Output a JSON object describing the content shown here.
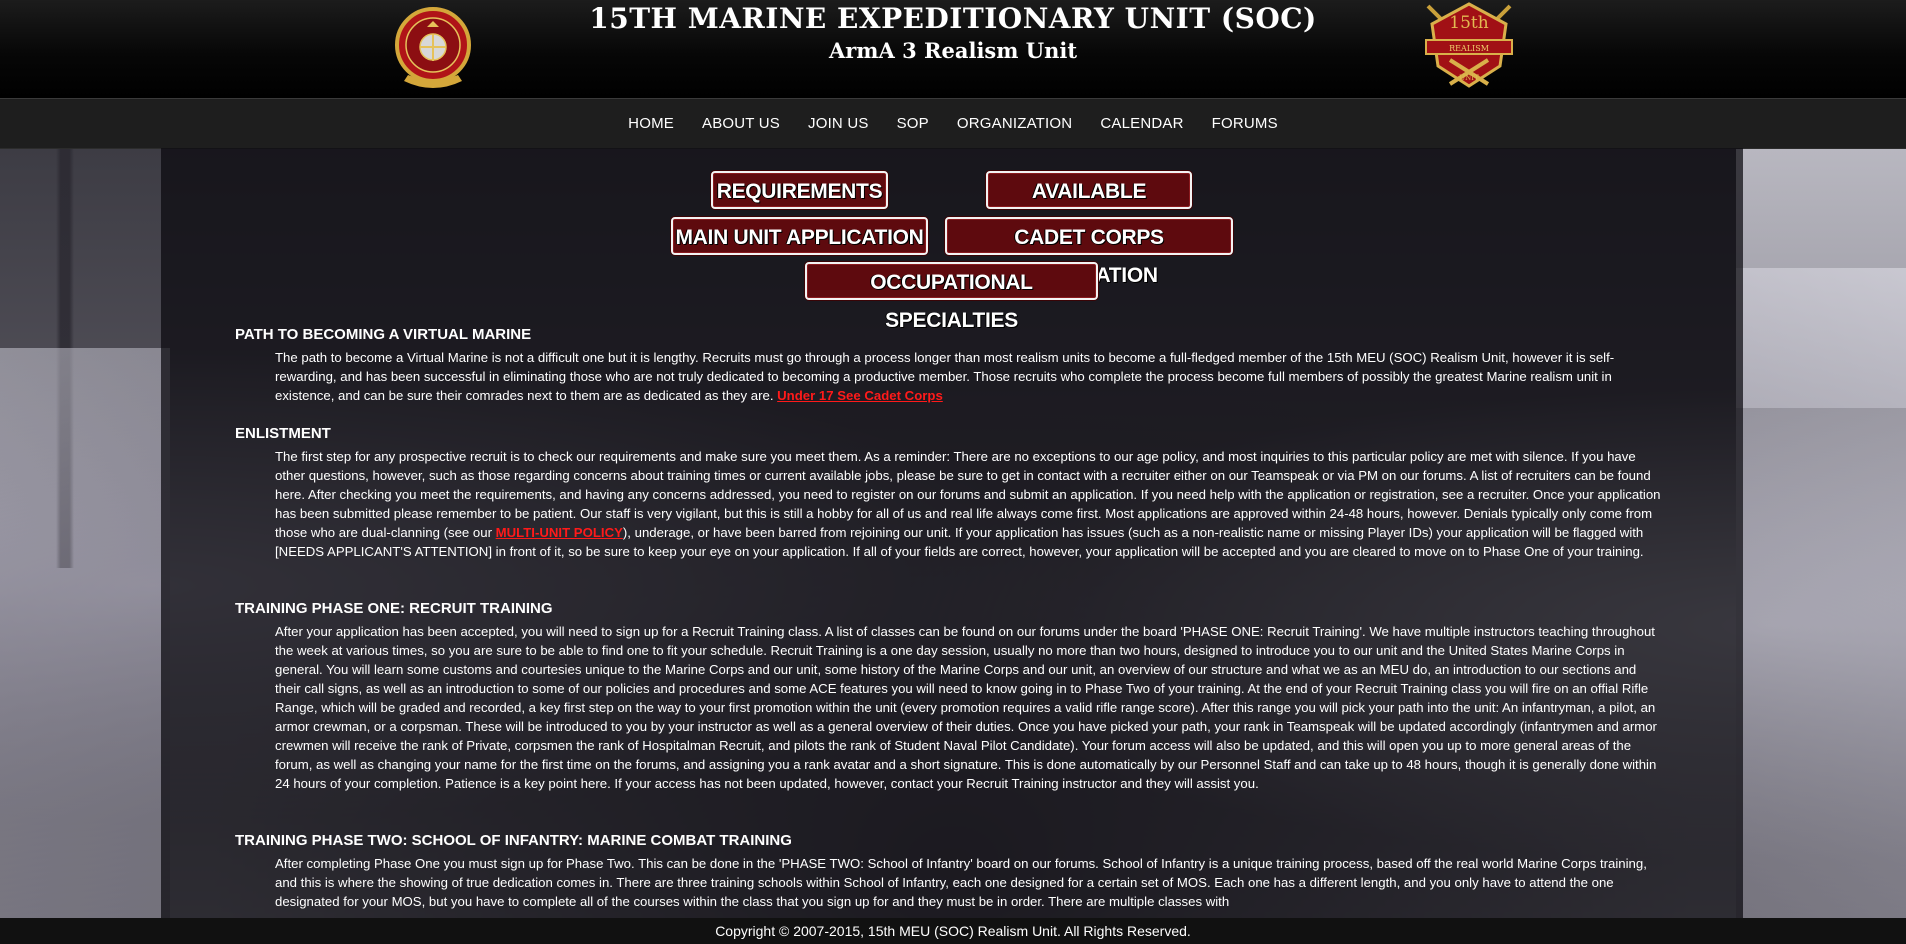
{
  "header": {
    "title": "15TH MARINE EXPEDITIONARY UNIT (SOC)",
    "subtitle": "ArmA 3 Realism Unit",
    "left_emblem_icon": "usmc-emblem-icon",
    "right_emblem_icon": "15th-realism-unit-badge-icon",
    "right_emblem_text_top": "15th",
    "right_emblem_text_mid": "REALISM",
    "right_emblem_text_bottom": "UNIT"
  },
  "nav": {
    "items": [
      {
        "label": "HOME"
      },
      {
        "label": "ABOUT US"
      },
      {
        "label": "JOIN US"
      },
      {
        "label": "SOP"
      },
      {
        "label": "ORGANIZATION"
      },
      {
        "label": "CALENDAR"
      },
      {
        "label": "FORUMS"
      }
    ]
  },
  "buttons": {
    "requirements": "REQUIREMENTS",
    "available_billets": "AVAILABLE BILLETS",
    "main_unit_application": "MAIN UNIT APPLICATION",
    "cadet_corps_application": "CADET CORPS APPLICATION",
    "occupational_specialties": "OCCUPATIONAL SPECIALTIES"
  },
  "sections": {
    "path": {
      "heading": "PATH TO BECOMING A VIRTUAL MARINE",
      "body": "The path to become a Virtual Marine is not a difficult one but it is lengthy. Recruits must go through a process longer than most realism units to become a full-fledged member of the 15th MEU (SOC) Realism Unit, however it is self-rewarding, and has been successful in eliminating those who are not truly dedicated to becoming a productive member. Those recruits who complete the process become full members of possibly the greatest Marine realism unit in existence, and can be sure their comrades next to them are as dedicated as they are.",
      "link": "Under 17 See Cadet Corps"
    },
    "enlistment": {
      "heading": "ENLISTMENT",
      "body_before": "The first step for any prospective recruit is to check our requirements and make sure you meet them. As a reminder: There are no exceptions to our age policy, and most inquiries to this particular policy are met with silence. If you have other questions, however, such as those regarding concerns about training times or current available jobs, please be sure to get in contact with a recruiter either on our Teamspeak or via PM on our forums. A list of recruiters can be found here. After checking you meet the requirements, and having any concerns addressed, you need to register on our forums and submit an application. If you need help with the application or registration, see a recruiter. Once your application has been submitted please remember to be patient. Our staff is very vigilant, but this is still a hobby for all of us and real life always come first. Most applications are approved within 24-48 hours, however. Denials typically only come from those who are dual-clanning (see our",
      "link": "MULTI-UNIT POLICY",
      "body_after": "), underage, or have been barred from rejoining our unit. If your application has issues (such as a non-realistic name or missing Player IDs) your application will be flagged with [NEEDS APPLICANT'S ATTENTION] in front of it, so be sure to keep your eye on your application. If all of your fields are correct, however, your application will be accepted and you are cleared to move on to Phase One of your training."
    },
    "phase_one": {
      "heading": "TRAINING PHASE ONE: RECRUIT TRAINING",
      "body": "After your application has been accepted, you will need to sign up for a Recruit Training class. A list of classes can be found on our forums under the board 'PHASE ONE: Recruit Training'. We have multiple instructors teaching throughout the week at various times, so you are sure to be able to find one to fit your schedule. Recruit Training is a one day session, usually no more than two hours, designed to introduce you to our unit and the United States Marine Corps in general. You will learn some customs and courtesies unique to the Marine Corps and our unit, some history of the Marine Corps and our unit, an overview of our structure and what we as an MEU do, an introduction to our sections and their call signs, as well as an introduction to some of our policies and procedures and some ACE features you will need to know going in to Phase Two of your training. At the end of your Recruit Training class you will fire on an offial Rifle Range, which will be graded and recorded, a key first step on the way to your first promotion within the unit (every promotion requires a valid rifle range score). After this range you will pick your path into the unit: An infantryman, a pilot, an armor crewman, or a corpsman. These will be introduced to you by your instructor as well as a general overview of their duties. Once you have picked your path, your rank in Teamspeak will be updated accordingly (infantrymen and armor crewmen will receive the rank of Private, corpsmen the rank of Hospitalman Recruit, and pilots the rank of Student Naval Pilot Candidate). Your forum access will also be updated, and this will open you up to more general areas of the forum, as well as changing your name for the first time on the forums, and assigning you a rank avatar and a short signature. This is done automatically by our Personnel Staff and can take up to 48 hours, though it is generally done within 24 hours of your completion. Patience is a key point here. If your access has not been updated, however, contact your Recruit Training instructor and they will assist you."
    },
    "phase_two": {
      "heading": "TRAINING PHASE TWO: SCHOOL OF INFANTRY: MARINE COMBAT TRAINING",
      "body": "After completing Phase One you must sign up for Phase Two. This can be done in the 'PHASE TWO: School of Infantry' board on our forums. School of Infantry is a unique training process, based off the real world Marine Corps training, and this is where the showing of true dedication comes in. There are three training schools within School of Infantry, each one designed for a certain set of MOS. Each one has a different length, and you only have to attend the one designated for your MOS, but you have to complete all of the courses within the class that you sign up for and they must be in order. There are multiple classes with"
    }
  },
  "footer": {
    "copyright": "Copyright © 2007-2015, 15th MEU (SOC) Realism Unit. All Rights Reserved."
  },
  "colors": {
    "button_bg": "#5e0a0e",
    "link": "#ff1a1a",
    "header_bg": "#000000",
    "nav_bg": "#1e1e1e"
  }
}
